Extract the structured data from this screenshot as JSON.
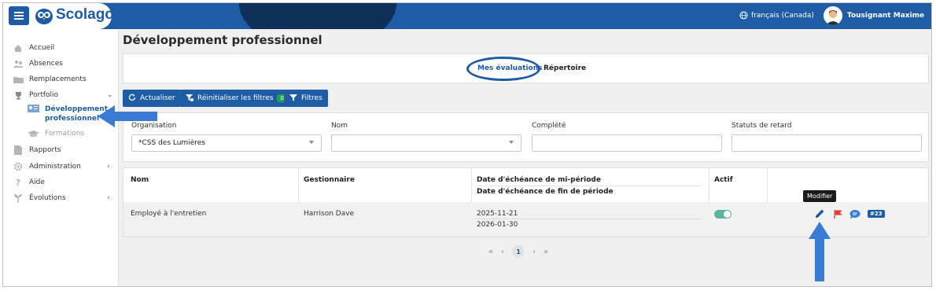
{
  "app": {
    "logo_text": "Scolago",
    "language": "français (Canada)",
    "user_name": "Tousignant Maxime"
  },
  "sidebar": {
    "items": [
      {
        "label": "Accueil",
        "icon": "home-icon"
      },
      {
        "label": "Absences",
        "icon": "people-icon"
      },
      {
        "label": "Remplacements",
        "icon": "folder-icon"
      },
      {
        "label": "Portfolio",
        "icon": "trophy-icon"
      },
      {
        "label": "Rapports",
        "icon": "document-icon"
      },
      {
        "label": "Administration",
        "icon": "gear-icon"
      },
      {
        "label": "Aide",
        "icon": "question-icon"
      },
      {
        "label": "Évolutions",
        "icon": "sprout-icon"
      }
    ],
    "sub_items": [
      {
        "label_line1": "Développement",
        "label_line2": "professionnel",
        "icon": "certificate-icon"
      },
      {
        "label": "Formations",
        "icon": "graduation-cap-icon"
      }
    ]
  },
  "page": {
    "title": "Développement professionnel",
    "tabs": [
      {
        "label": "Mes évaluations",
        "active": true
      },
      {
        "label": "Répertoire",
        "active": false
      }
    ]
  },
  "toolbar": {
    "refresh_label": "Actualiser",
    "reset_label": "Réinitialiser les filtres",
    "reset_count": "0",
    "filters_label": "Filtres"
  },
  "filters": {
    "organisation": {
      "label": "Organisation",
      "value": "*CSS des Lumières"
    },
    "nom": {
      "label": "Nom",
      "value": ""
    },
    "complete": {
      "label": "Complété",
      "value": ""
    },
    "statuts": {
      "label": "Statuts de retard",
      "value": ""
    }
  },
  "table": {
    "headers": {
      "nom": "Nom",
      "gestionnaire": "Gestionnaire",
      "date_mi": "Date d'échéance de mi-période",
      "date_fin": "Date d'échéance de fin de période",
      "actif": "Actif"
    },
    "rows": [
      {
        "nom": "Employé à l'entretien",
        "gestionnaire": "Harrison Dave",
        "date_mi": "2025-11-21",
        "date_fin": "2026-01-30",
        "actif": true,
        "badge": "#23"
      }
    ],
    "tooltip": "Modifier"
  },
  "pagination": {
    "current_page": "1"
  },
  "colors": {
    "primary": "#1f5ca6",
    "toggle_on": "#5ab5a3",
    "badge_green": "#27a057",
    "flag_red": "#e0393e"
  }
}
